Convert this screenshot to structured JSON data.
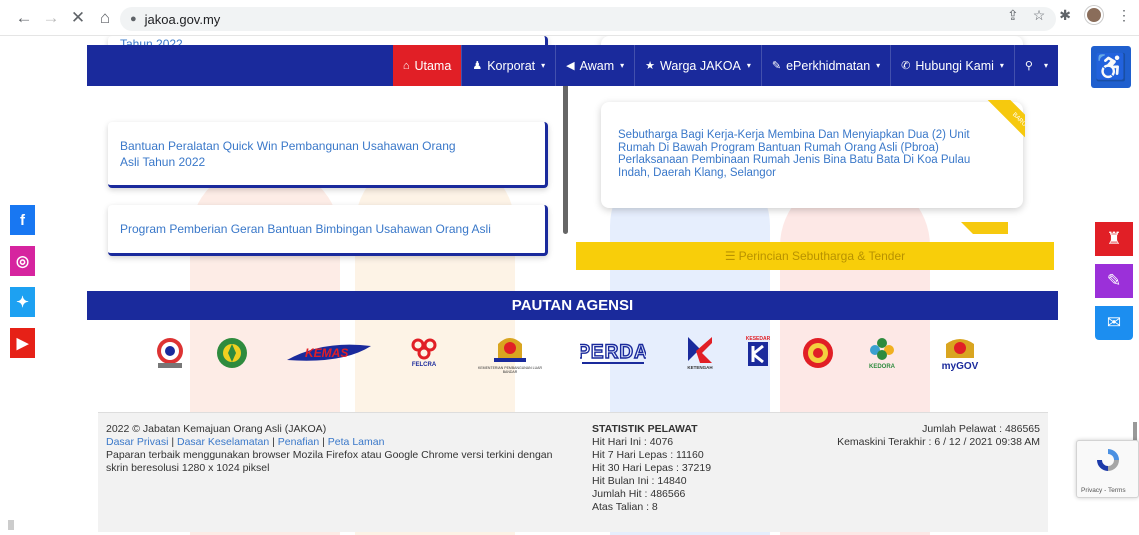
{
  "browser": {
    "url": "jakoa.gov.my",
    "back_glyph": "←",
    "forward_glyph": "→",
    "close_glyph": "✕",
    "home_glyph": "⌂",
    "lock_glyph": "🔒"
  },
  "nav": {
    "items": [
      {
        "label": "Utama",
        "icon": "home-icon",
        "glyph": "⌂",
        "active": true
      },
      {
        "label": "Korporat",
        "icon": "users-icon",
        "glyph": "♟",
        "caret": true
      },
      {
        "label": "Awam",
        "icon": "bullhorn-icon",
        "glyph": "◀",
        "caret": true
      },
      {
        "label": "Warga JAKOA",
        "icon": "star-icon",
        "glyph": "★",
        "caret": true
      },
      {
        "label": "ePerkhidmatan",
        "icon": "pencil-icon",
        "glyph": "✎",
        "caret": true
      },
      {
        "label": "Hubungi Kami",
        "icon": "phone-icon",
        "glyph": "✆",
        "caret": true
      },
      {
        "label": "",
        "icon": "search-icon",
        "glyph": "⚲",
        "caret": true
      }
    ],
    "caret_glyph": "▾"
  },
  "accessibility_glyph": "♿",
  "left_cards": [
    {
      "text": "Tahun 2022"
    },
    {
      "text": "Bantuan Peralatan Quick Win Pembangunan Usahawan Orang Asli Tahun 2022"
    },
    {
      "text": "Program Pemberian Geran Bantuan Bimbingan Usahawan Orang Asli"
    }
  ],
  "right_card": {
    "text": "Sebutharga Bagi Kerja-Kerja Membina Dan Menyiapkan Dua (2) Unit Rumah Di Bawah Program Bantuan Rumah Orang Asli (Pbroa) Perlaksanaan Pembinaan Rumah Jenis Bina Batu Bata Di Koa Pulau Indah, Daerah Klang, Selangor",
    "ribbon": "BARU"
  },
  "tender_button": "Perincian Sebutharga & Tender",
  "tender_glyph": "☰",
  "pautan_title": "PAUTAN AGENSI",
  "agencies": [
    {
      "name": "jakoa-logo",
      "label": ""
    },
    {
      "name": "risda-logo",
      "label": ""
    },
    {
      "name": "kemas-logo",
      "label": "KEMAS"
    },
    {
      "name": "felcra-logo",
      "label": "FELCRA"
    },
    {
      "name": "kpkt-logo",
      "label": "KEMENTERIAN PEMBANGUNAN LUAR BANDAR"
    },
    {
      "name": "perda-logo",
      "label": "PERDA"
    },
    {
      "name": "ketengah-logo",
      "label": "KETENGAH"
    },
    {
      "name": "kesedar-logo",
      "label": "KESEDAR"
    },
    {
      "name": "kejora-seal-logo",
      "label": ""
    },
    {
      "name": "kedora-logo",
      "label": "KEDORA"
    },
    {
      "name": "mygov-logo",
      "label": "myGOV"
    }
  ],
  "footer": {
    "copyright": "2022 © Jabatan Kemajuan Orang Asli (JAKOA)",
    "links": [
      "Dasar Privasi",
      "Dasar Keselamatan",
      "Penafian",
      "Peta Laman"
    ],
    "separator": " | ",
    "browser_note": "Paparan terbaik menggunakan browser Mozila Firefox atau Google Chrome versi terkini dengan skrin beresolusi 1280 x 1024 piksel",
    "stats_title": "STATISTIK PELAWAT",
    "stats": [
      "Hit Hari Ini : 4076",
      "Hit 7 Hari Lepas : 11160",
      "Hit 30 Hari Lepas : 37219",
      "Hit Bulan Ini : 14840",
      "Jumlah Hit : 486566",
      "Atas Talian : 8"
    ],
    "total_visitors": "Jumlah Pelawat : 486565",
    "last_updated": "Kemaskini Terakhir : 6 / 12 / 2021 09:38 AM"
  },
  "social": [
    {
      "name": "facebook-icon",
      "glyph": "f",
      "color": "#1877f2"
    },
    {
      "name": "instagram-icon",
      "glyph": "◎",
      "color": "#d6249f"
    },
    {
      "name": "twitter-icon",
      "glyph": "✦",
      "color": "#1da1f2"
    },
    {
      "name": "youtube-icon",
      "glyph": "▶",
      "color": "#e62117"
    }
  ],
  "right_side": [
    {
      "name": "library-icon",
      "glyph": "♜",
      "color": "#e11f26"
    },
    {
      "name": "edit-icon",
      "glyph": "✎",
      "color": "#9b30d9"
    },
    {
      "name": "mail-icon",
      "glyph": "✉",
      "color": "#1c8ef0"
    }
  ],
  "recaptcha": {
    "terms": "Privacy - Terms"
  }
}
